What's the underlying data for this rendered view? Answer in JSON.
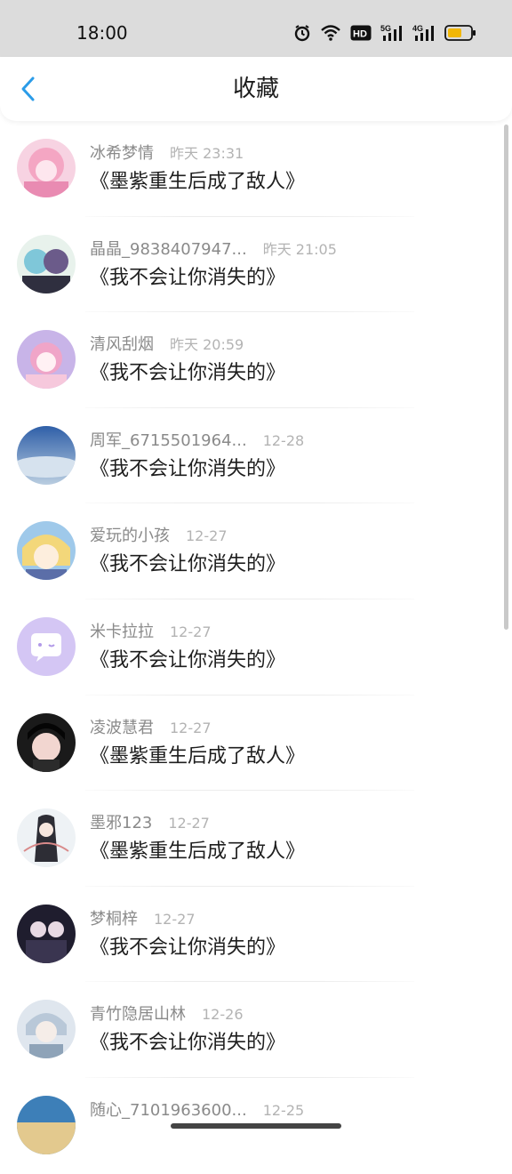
{
  "status_bar": {
    "time": "18:00",
    "icons": [
      "alarm-icon",
      "wifi-icon",
      "hd-icon",
      "5g-signal-icon",
      "4g-signal-icon",
      "battery-icon"
    ],
    "hd_label": "HD",
    "net1": "5G",
    "net2": "4G"
  },
  "header": {
    "title": "收藏",
    "back_icon": "chevron-left-icon",
    "accent": "#2b9ce8"
  },
  "list": [
    {
      "username": "冰希梦情",
      "time": "昨天 23:31",
      "title": "《墨紫重生后成了敌人》",
      "avatar_color": "#f4a6c3"
    },
    {
      "username": "晶晶_9838407947...",
      "time": "昨天 21:05",
      "title": "《我不会让你消失的》",
      "avatar_color": "#7fc7d9"
    },
    {
      "username": "清风刮烟",
      "time": "昨天 20:59",
      "title": "《我不会让你消失的》",
      "avatar_color": "#f0a5c8"
    },
    {
      "username": "周军_6715501964...",
      "time": "12-28",
      "title": "《我不会让你消失的》",
      "avatar_color": "#6f8fb8"
    },
    {
      "username": "爱玩的小孩",
      "time": "12-27",
      "title": "《我不会让你消失的》",
      "avatar_color": "#f3d77a"
    },
    {
      "username": "米卡拉拉",
      "time": "12-27",
      "title": "《我不会让你消失的》",
      "avatar_color": "#d4c6f4"
    },
    {
      "username": "凌波慧君",
      "time": "12-27",
      "title": "《墨紫重生后成了敌人》",
      "avatar_color": "#2a2a2a"
    },
    {
      "username": "墨邪123",
      "time": "12-27",
      "title": "《墨紫重生后成了敌人》",
      "avatar_color": "#e9eef2"
    },
    {
      "username": "梦桐梓",
      "time": "12-27",
      "title": "《我不会让你消失的》",
      "avatar_color": "#3a3550"
    },
    {
      "username": "青竹隐居山林",
      "time": "12-26",
      "title": "《我不会让你消失的》",
      "avatar_color": "#b9c8d8"
    },
    {
      "username": "随心_7101963600...",
      "time": "12-25",
      "title": "",
      "avatar_color": "#3d7fb8"
    }
  ]
}
